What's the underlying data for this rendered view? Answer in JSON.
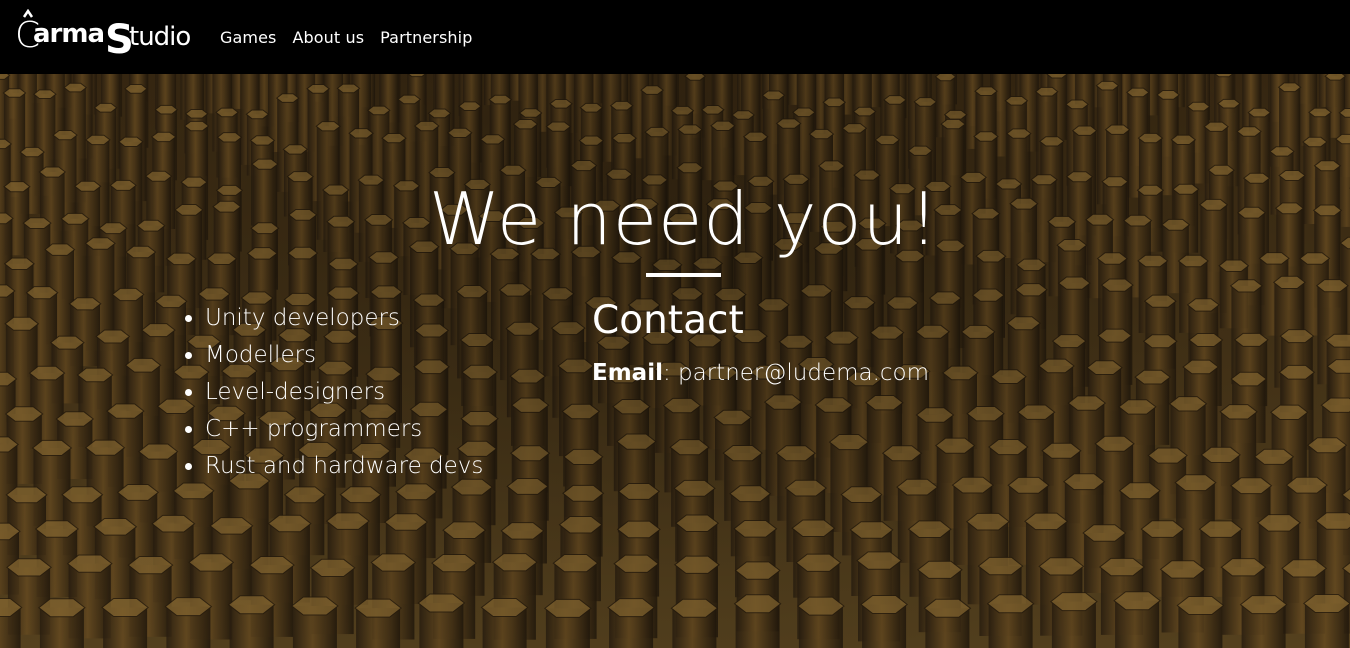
{
  "brand": {
    "name": "Carma Studio"
  },
  "nav": {
    "items": [
      "Games",
      "About us",
      "Partnership"
    ]
  },
  "hero": {
    "title": "We need you!",
    "roles": [
      "Unity developers",
      "Modellers",
      "Level-designers",
      "C++ programmers",
      "Rust and hardware devs"
    ],
    "contact": {
      "title": "Contact",
      "email_label": "Email",
      "separator": ":",
      "email": "partner@ludema.com"
    }
  },
  "colors": {
    "navbar_bg": "#000000",
    "text": "#ffffff",
    "hero_tone": "#4a3618"
  }
}
